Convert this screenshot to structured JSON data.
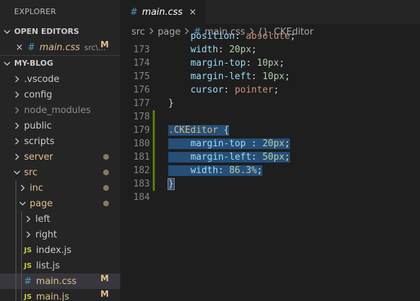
{
  "explorer": {
    "title": "EXPLORER",
    "open_editors_label": "OPEN EDITORS",
    "open_editors": [
      {
        "close": "×",
        "name": "main.css",
        "path": "src\\...",
        "badge": "M"
      }
    ],
    "project_label": "MY-BLOG",
    "tree": [
      {
        "name": ".vscode"
      },
      {
        "name": "config"
      },
      {
        "name": "node_modules"
      },
      {
        "name": "public"
      },
      {
        "name": "scripts"
      },
      {
        "name": "server"
      },
      {
        "name": "src"
      },
      {
        "name": "inc"
      },
      {
        "name": "page"
      },
      {
        "name": "left"
      },
      {
        "name": "right"
      },
      {
        "name": "index.js",
        "icon": "JS"
      },
      {
        "name": "list.js",
        "icon": "JS"
      },
      {
        "name": "main.css",
        "icon": "#",
        "badge": "M"
      },
      {
        "name": "main.js",
        "icon": "JS",
        "badge": "M"
      }
    ]
  },
  "tab": {
    "icon": "#",
    "title": "main.css",
    "close": "×"
  },
  "breadcrumb": [
    "src",
    "page",
    "main.css",
    ".CKEditor"
  ],
  "breadcrumb_hash": "#",
  "breadcrumb_symbol": "{}",
  "code": {
    "lines": [
      {
        "n": "173",
        "indent": "    ",
        "prop": "position",
        "colon": ": ",
        "val": "absolute",
        "end": ";"
      },
      {
        "n": "174",
        "indent": "    ",
        "prop": "width",
        "colon": ": ",
        "val": "20px",
        "end": ";"
      },
      {
        "n": "175",
        "indent": "    ",
        "prop": "margin-top",
        "colon": ": ",
        "val": "10px",
        "end": ";"
      },
      {
        "n": "176",
        "indent": "    ",
        "prop": "margin-left",
        "colon": ": ",
        "val": "10px",
        "end": ";"
      },
      {
        "n": "177",
        "indent": "    ",
        "prop": "cursor",
        "colon": ": ",
        "val": "pointer",
        "end": ";"
      },
      {
        "n": "178",
        "text": "}"
      },
      {
        "n": "179",
        "text": ""
      },
      {
        "n": "180",
        "selector": ".CKEditor",
        "open": " {"
      },
      {
        "n": "181",
        "indent": "    ",
        "prop": "margin-top",
        "colon": " : ",
        "val": "20px",
        "end": ";"
      },
      {
        "n": "182",
        "indent": "    ",
        "prop": "margin-left",
        "colon": ": ",
        "val": "50px",
        "end": ";"
      },
      {
        "n": "183",
        "indent": "    ",
        "prop": "width",
        "colon": ": ",
        "val": "86.3%",
        "end": ";"
      },
      {
        "n": "184",
        "text": "}"
      }
    ]
  },
  "colors": {
    "sidebar_bg": "#252526",
    "editor_bg": "#1e1e1e",
    "selection": "#264f78",
    "modified": "#e2c08d",
    "git_added_gutter": "#587c0c"
  }
}
